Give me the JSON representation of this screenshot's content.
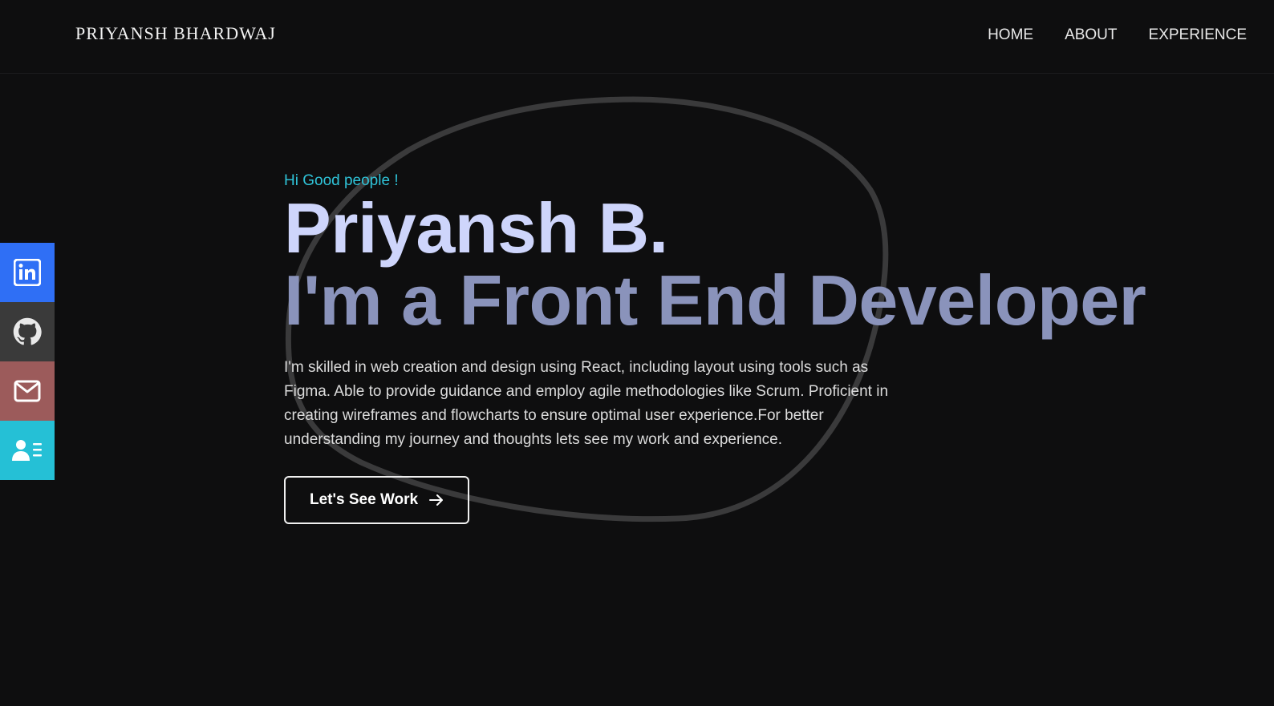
{
  "header": {
    "brand": "PRIYANSH BHARDWAJ",
    "nav": [
      {
        "label": "HOME"
      },
      {
        "label": "ABOUT"
      },
      {
        "label": "EXPERIENCE"
      }
    ]
  },
  "hero": {
    "greeting": "Hi Good people !",
    "name": "Priyansh B.",
    "role": "I'm a Front End Developer",
    "description": "I'm skilled in web creation and design using React, including layout using tools such as Figma. Able to provide guidance and employ agile methodologies like Scrum. Proficient in creating wireframes and flowcharts to ensure optimal user experience.For better understanding my journey and thoughts lets see my work and experience.",
    "cta_label": "Let's See Work",
    "cta_icon": "arrow-right-icon"
  },
  "social": [
    {
      "name": "linkedin",
      "icon": "linkedin-icon",
      "color": "#2f6ff5"
    },
    {
      "name": "github",
      "icon": "github-icon",
      "color": "#3a3a3a"
    },
    {
      "name": "email",
      "icon": "mail-icon",
      "color": "#9c5b5b"
    },
    {
      "name": "resume",
      "icon": "contact-card-icon",
      "color": "#25c0d6"
    }
  ],
  "colors": {
    "background": "#0e0e0f",
    "accent": "#2fc3d8",
    "name": "#ced5fb",
    "role": "#8a93bb"
  }
}
